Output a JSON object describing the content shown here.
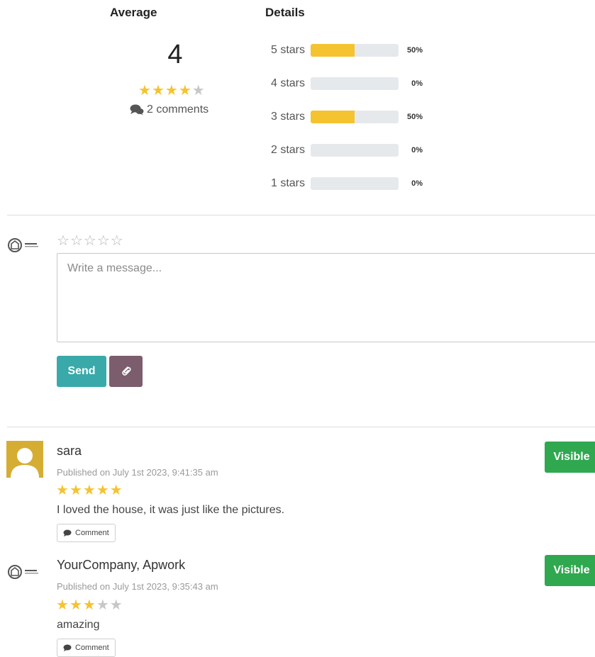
{
  "summary": {
    "average_heading": "Average",
    "details_heading": "Details",
    "average_value": "4",
    "average_rating": 4,
    "comments_label": "2 comments",
    "breakdown": [
      {
        "label": "5 stars",
        "fraction": 0.5,
        "pct": "50%"
      },
      {
        "label": "4 stars",
        "fraction": 0.0,
        "pct": "0%"
      },
      {
        "label": "3 stars",
        "fraction": 0.5,
        "pct": "50%"
      },
      {
        "label": "2 stars",
        "fraction": 0.0,
        "pct": "0%"
      },
      {
        "label": "1 stars",
        "fraction": 0.0,
        "pct": "0%"
      }
    ]
  },
  "composer": {
    "rating": 0,
    "message_placeholder": "Write a message...",
    "send_label": "Send",
    "attach_icon": "paperclip-icon"
  },
  "reviews": [
    {
      "author": "sara",
      "published": "Published on July 1st 2023, 9:41:35 am",
      "rating": 5,
      "text": "I loved the house, it was just like the pictures.",
      "comment_label": "Comment",
      "visibility_label": "Visible",
      "avatar": "user-silhouette-avatar"
    },
    {
      "author": "YourCompany, Apwork",
      "published": "Published on July 1st 2023, 9:35:43 am",
      "rating": 3,
      "text": "amazing",
      "comment_label": "Comment",
      "visibility_label": "Visible",
      "avatar": "company-logo-avatar"
    }
  ],
  "colors": {
    "star": "#f5c330",
    "star_off": "#c7c7c7",
    "send": "#3aa9a9",
    "attach": "#7c5d6d",
    "visible": "#2fa84f",
    "bar_track": "#e6e9ec"
  }
}
